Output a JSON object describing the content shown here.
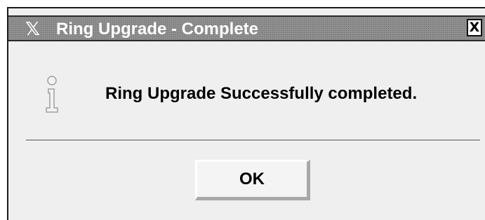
{
  "window": {
    "title": "Ring Upgrade - Complete",
    "title_icon": "x-window-icon",
    "close_label": "X"
  },
  "dialog": {
    "icon": "info-icon",
    "message": "Ring Upgrade Successfully completed."
  },
  "buttons": {
    "ok_label": "OK"
  },
  "colors": {
    "titlebar": "#8f8f8f",
    "background": "#efefef",
    "title_text": "#ffffff"
  }
}
